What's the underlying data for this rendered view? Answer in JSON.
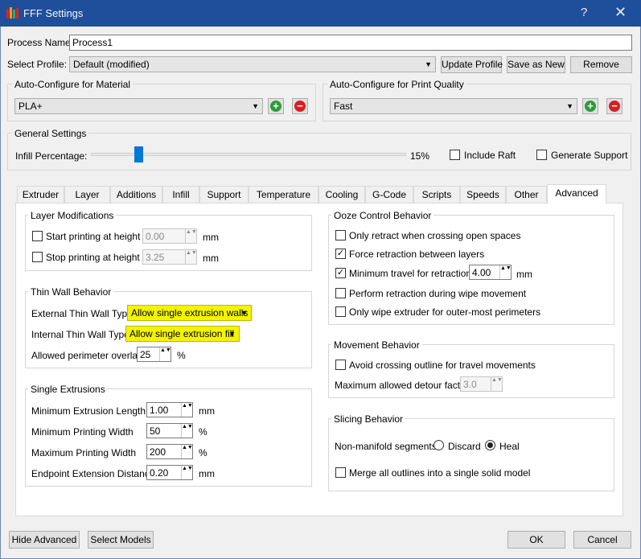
{
  "window": {
    "title": "FFF Settings",
    "help_glyph": "?",
    "close_glyph": "✕"
  },
  "process": {
    "name_label": "Process Name:",
    "name_value": "Process1",
    "profile_label": "Select Profile:",
    "profile_value": "Default (modified)",
    "update_btn": "Update Profile",
    "save_new_btn": "Save as New",
    "remove_btn": "Remove"
  },
  "autoconf_material": {
    "title": "Auto-Configure for Material",
    "value": "PLA+"
  },
  "autoconf_quality": {
    "title": "Auto-Configure for Print Quality",
    "value": "Fast"
  },
  "general": {
    "title": "General Settings",
    "infill_label": "Infill Percentage:",
    "infill_value": "15%",
    "infill_fraction": 0.15,
    "include_raft": "Include Raft",
    "generate_support": "Generate Support"
  },
  "tabs": [
    "Extruder",
    "Layer",
    "Additions",
    "Infill",
    "Support",
    "Temperature",
    "Cooling",
    "G-Code",
    "Scripts",
    "Speeds",
    "Other",
    "Advanced"
  ],
  "active_tab": "Advanced",
  "layer_mod": {
    "title": "Layer Modifications",
    "start_label": "Start printing at height",
    "start_value": "0.00",
    "stop_label": "Stop printing at height",
    "stop_value": "3.25",
    "unit": "mm"
  },
  "thin_wall": {
    "title": "Thin Wall Behavior",
    "external_label": "External Thin Wall Type",
    "external_value": "Allow single extrusion walls",
    "internal_label": "Internal Thin Wall Type",
    "internal_value": "Allow single extrusion fill",
    "overlap_label": "Allowed perimeter overlap",
    "overlap_value": "25",
    "overlap_unit": "%"
  },
  "single_ext": {
    "title": "Single Extrusions",
    "min_len_label": "Minimum Extrusion Length",
    "min_len_value": "1.00",
    "min_len_unit": "mm",
    "min_width_label": "Minimum Printing Width",
    "min_width_value": "50",
    "min_width_unit": "%",
    "max_width_label": "Maximum Printing Width",
    "max_width_value": "200",
    "max_width_unit": "%",
    "endpoint_label": "Endpoint Extension Distance",
    "endpoint_value": "0.20",
    "endpoint_unit": "mm"
  },
  "ooze": {
    "title": "Ooze Control Behavior",
    "only_retract": "Only retract when crossing open spaces",
    "force_retract": "Force retraction between layers",
    "min_travel": "Minimum travel for retraction",
    "min_travel_value": "4.00",
    "min_travel_unit": "mm",
    "perform_retract": "Perform retraction during wipe movement",
    "only_wipe": "Only wipe extruder for outer-most perimeters"
  },
  "movement": {
    "title": "Movement Behavior",
    "avoid_crossing": "Avoid crossing outline for travel movements",
    "detour_label": "Maximum allowed detour factor",
    "detour_value": "3.0"
  },
  "slicing": {
    "title": "Slicing Behavior",
    "nonmanifold_label": "Non-manifold segments:",
    "discard": "Discard",
    "heal": "Heal",
    "merge": "Merge all outlines into a single solid model"
  },
  "footer": {
    "hide_advanced": "Hide Advanced",
    "select_models": "Select Models",
    "ok": "OK",
    "cancel": "Cancel"
  },
  "check_glyph": "✓",
  "arrow_glyph": "▼",
  "spin_glyph": "▲▼"
}
